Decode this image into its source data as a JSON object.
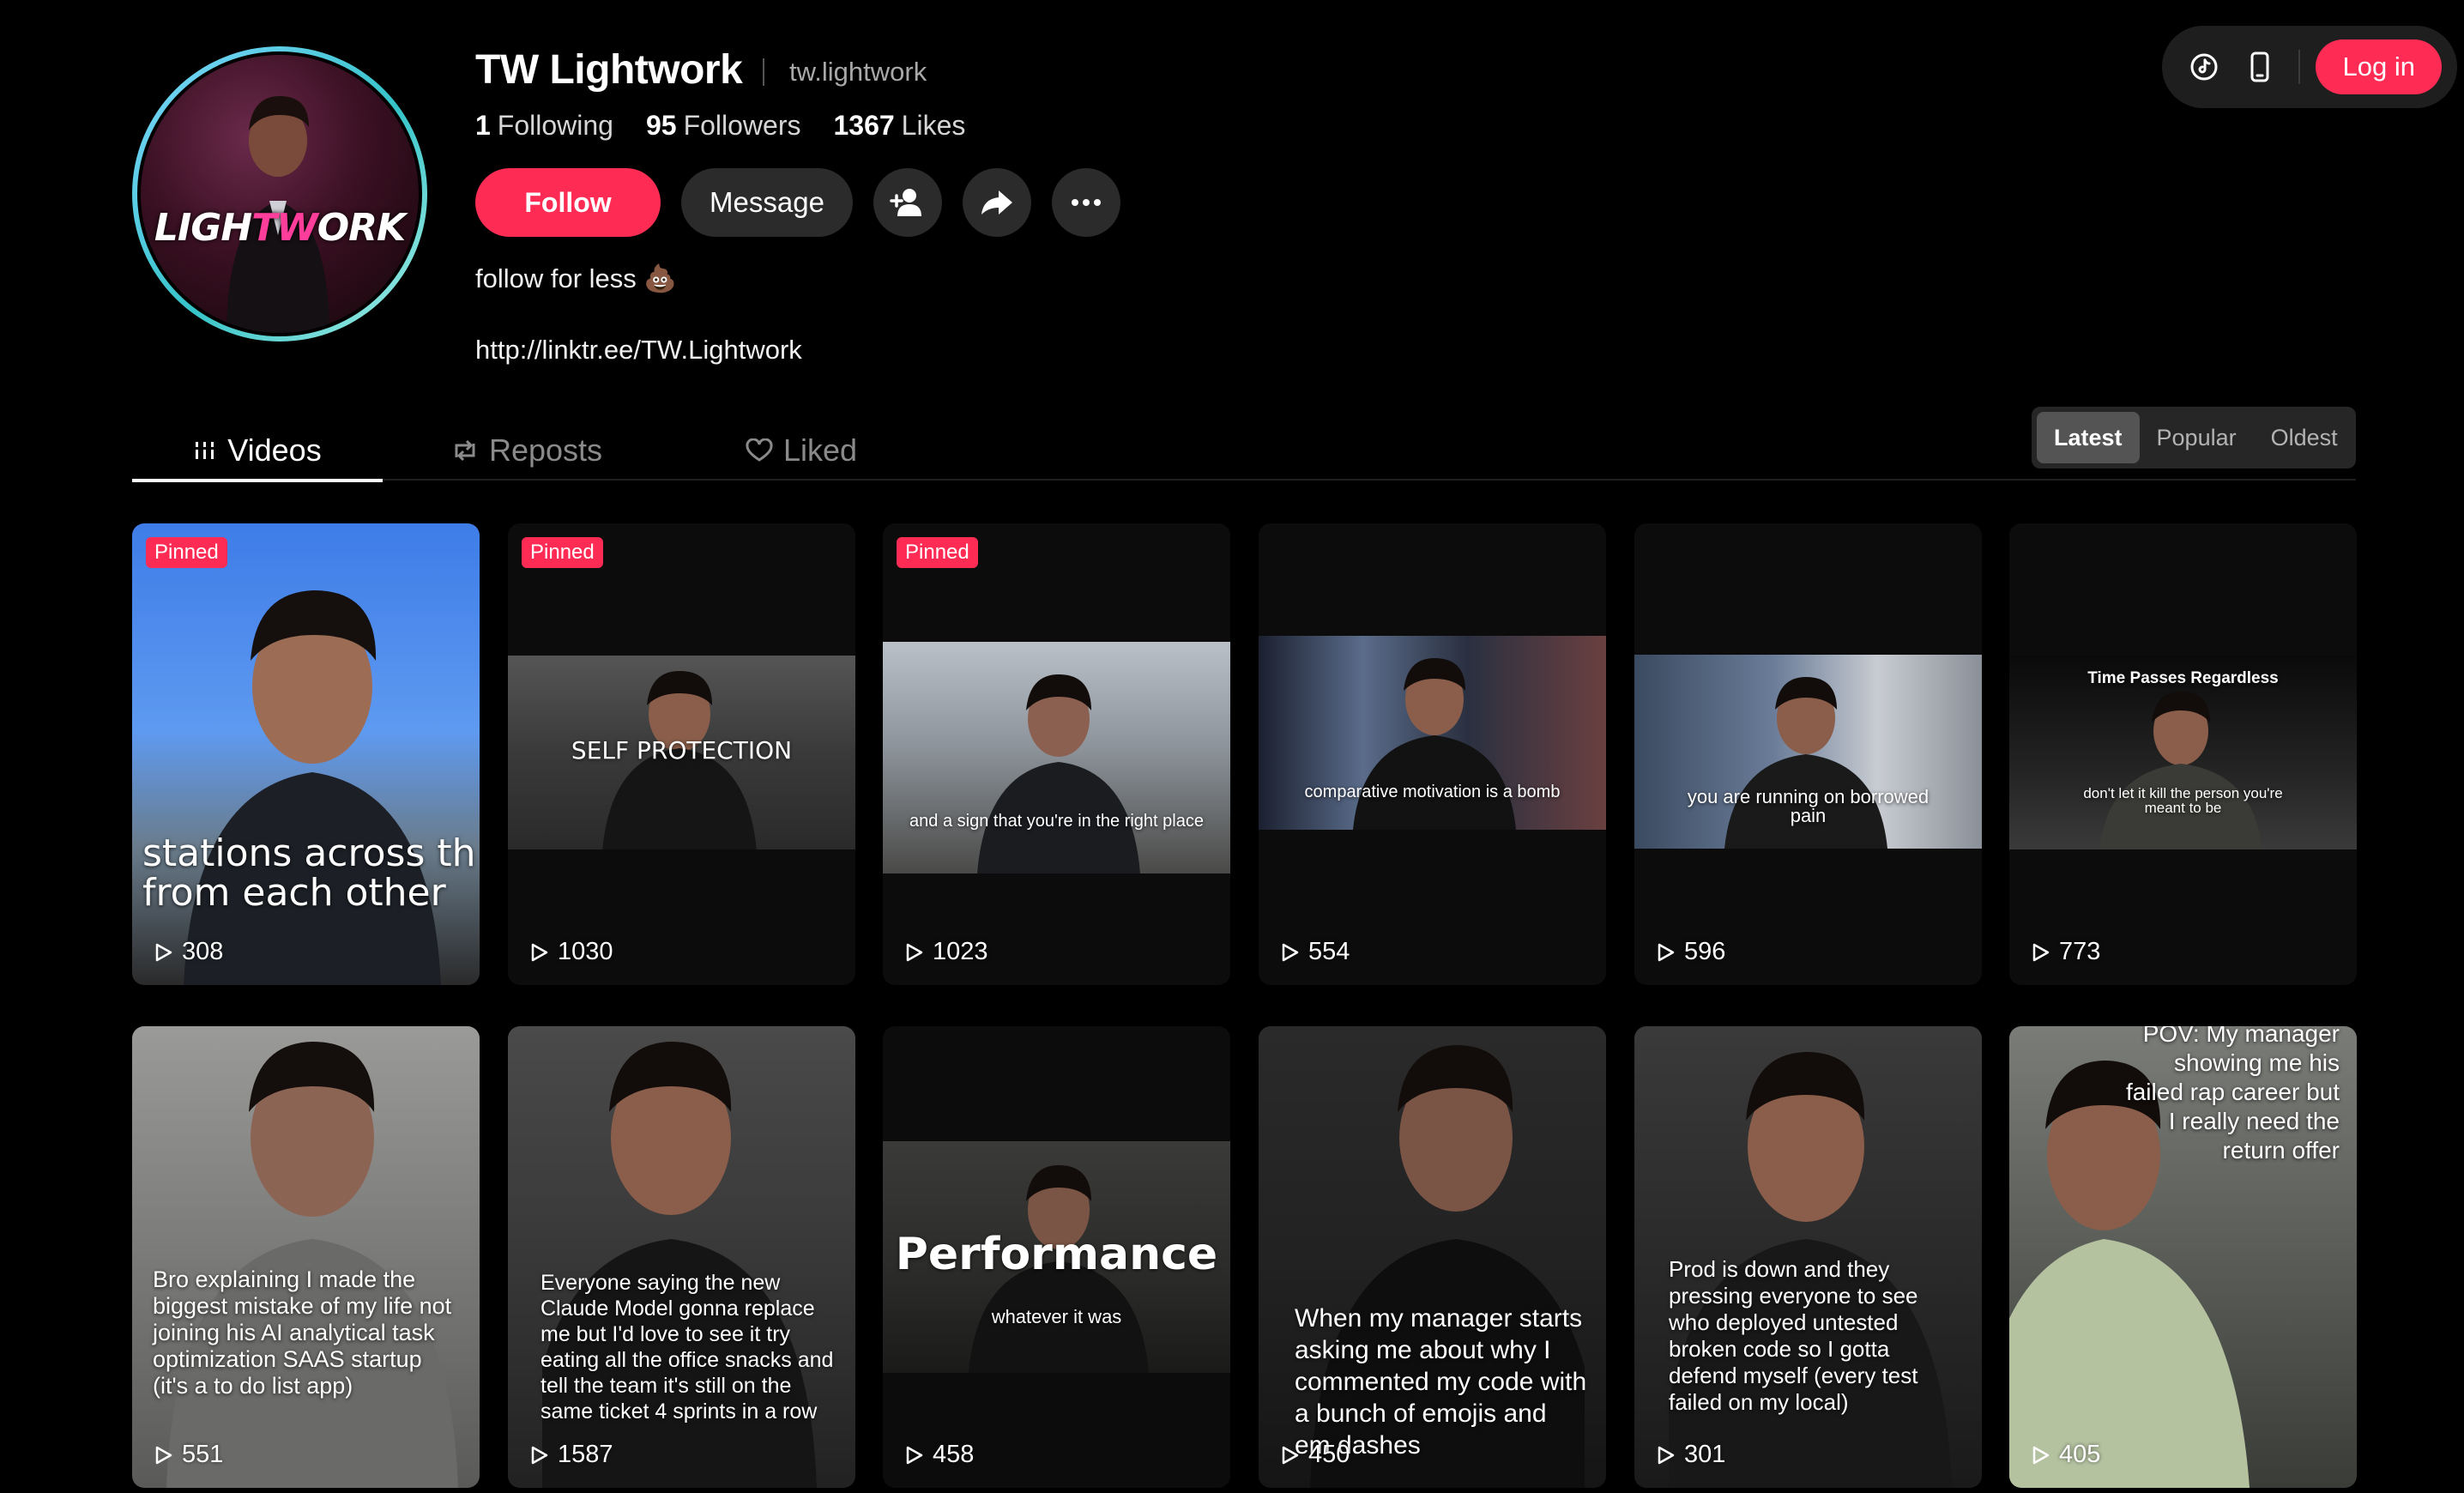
{
  "header": {
    "tiktok_icon": "tiktok-logo-icon",
    "device_icon": "mobile-device-icon",
    "login_label": "Log in"
  },
  "profile": {
    "avatar_text_left": "LIGH",
    "avatar_text_tw": "TW",
    "avatar_text_right": "ORK",
    "name": "TW Lightwork",
    "handle": "tw.lightwork",
    "following_count": "1",
    "following_label": "Following",
    "followers_count": "95",
    "followers_label": "Followers",
    "likes_count": "1367",
    "likes_label": "Likes",
    "follow_label": "Follow",
    "message_label": "Message",
    "bio": "follow for less 💩",
    "link": "http://linktr.ee/TW.Lightwork"
  },
  "tabs": [
    {
      "label": "Videos",
      "active": true
    },
    {
      "label": "Reposts",
      "active": false
    },
    {
      "label": "Liked",
      "active": false
    }
  ],
  "sort": [
    {
      "label": "Latest",
      "active": true
    },
    {
      "label": "Popular",
      "active": false
    },
    {
      "label": "Oldest",
      "active": false
    }
  ],
  "videos": [
    {
      "pinned": true,
      "pin_label": "Pinned",
      "views": "308",
      "caption": "stations across th\nfrom each other"
    },
    {
      "pinned": true,
      "pin_label": "Pinned",
      "views": "1030",
      "caption": "SELF PROTECTION"
    },
    {
      "pinned": true,
      "pin_label": "Pinned",
      "views": "1023",
      "caption": "and a sign that you're in the right place"
    },
    {
      "pinned": false,
      "views": "554",
      "caption": "comparative motivation is a bomb"
    },
    {
      "pinned": false,
      "views": "596",
      "caption": "you are running on borrowed\npain"
    },
    {
      "pinned": false,
      "views": "773",
      "caption_title": "Time Passes Regardless",
      "caption": "don't let it kill the person you're\nmeant to be"
    },
    {
      "pinned": false,
      "views": "551",
      "caption": "Bro explaining I made the biggest mistake of my life not joining his AI analytical task optimization SAAS startup (it's a to do list app)"
    },
    {
      "pinned": false,
      "views": "1587",
      "caption": "Everyone saying the new Claude Model gonna replace me but I'd love to see it try eating all the office snacks and tell the team it's still on the same ticket 4 sprints in a row"
    },
    {
      "pinned": false,
      "views": "458",
      "caption_title": "Performance",
      "caption": "whatever it was"
    },
    {
      "pinned": false,
      "views": "450",
      "caption": "When my manager starts asking me about why I commented my code with a bunch of emojis and em dashes"
    },
    {
      "pinned": false,
      "views": "301",
      "caption": "Prod is down and they pressing everyone to see who deployed untested broken code so I gotta defend myself (every test failed on my local)"
    },
    {
      "pinned": false,
      "views": "405",
      "caption": "POV: My manager showing me his failed rap career but I really need the return offer"
    }
  ]
}
